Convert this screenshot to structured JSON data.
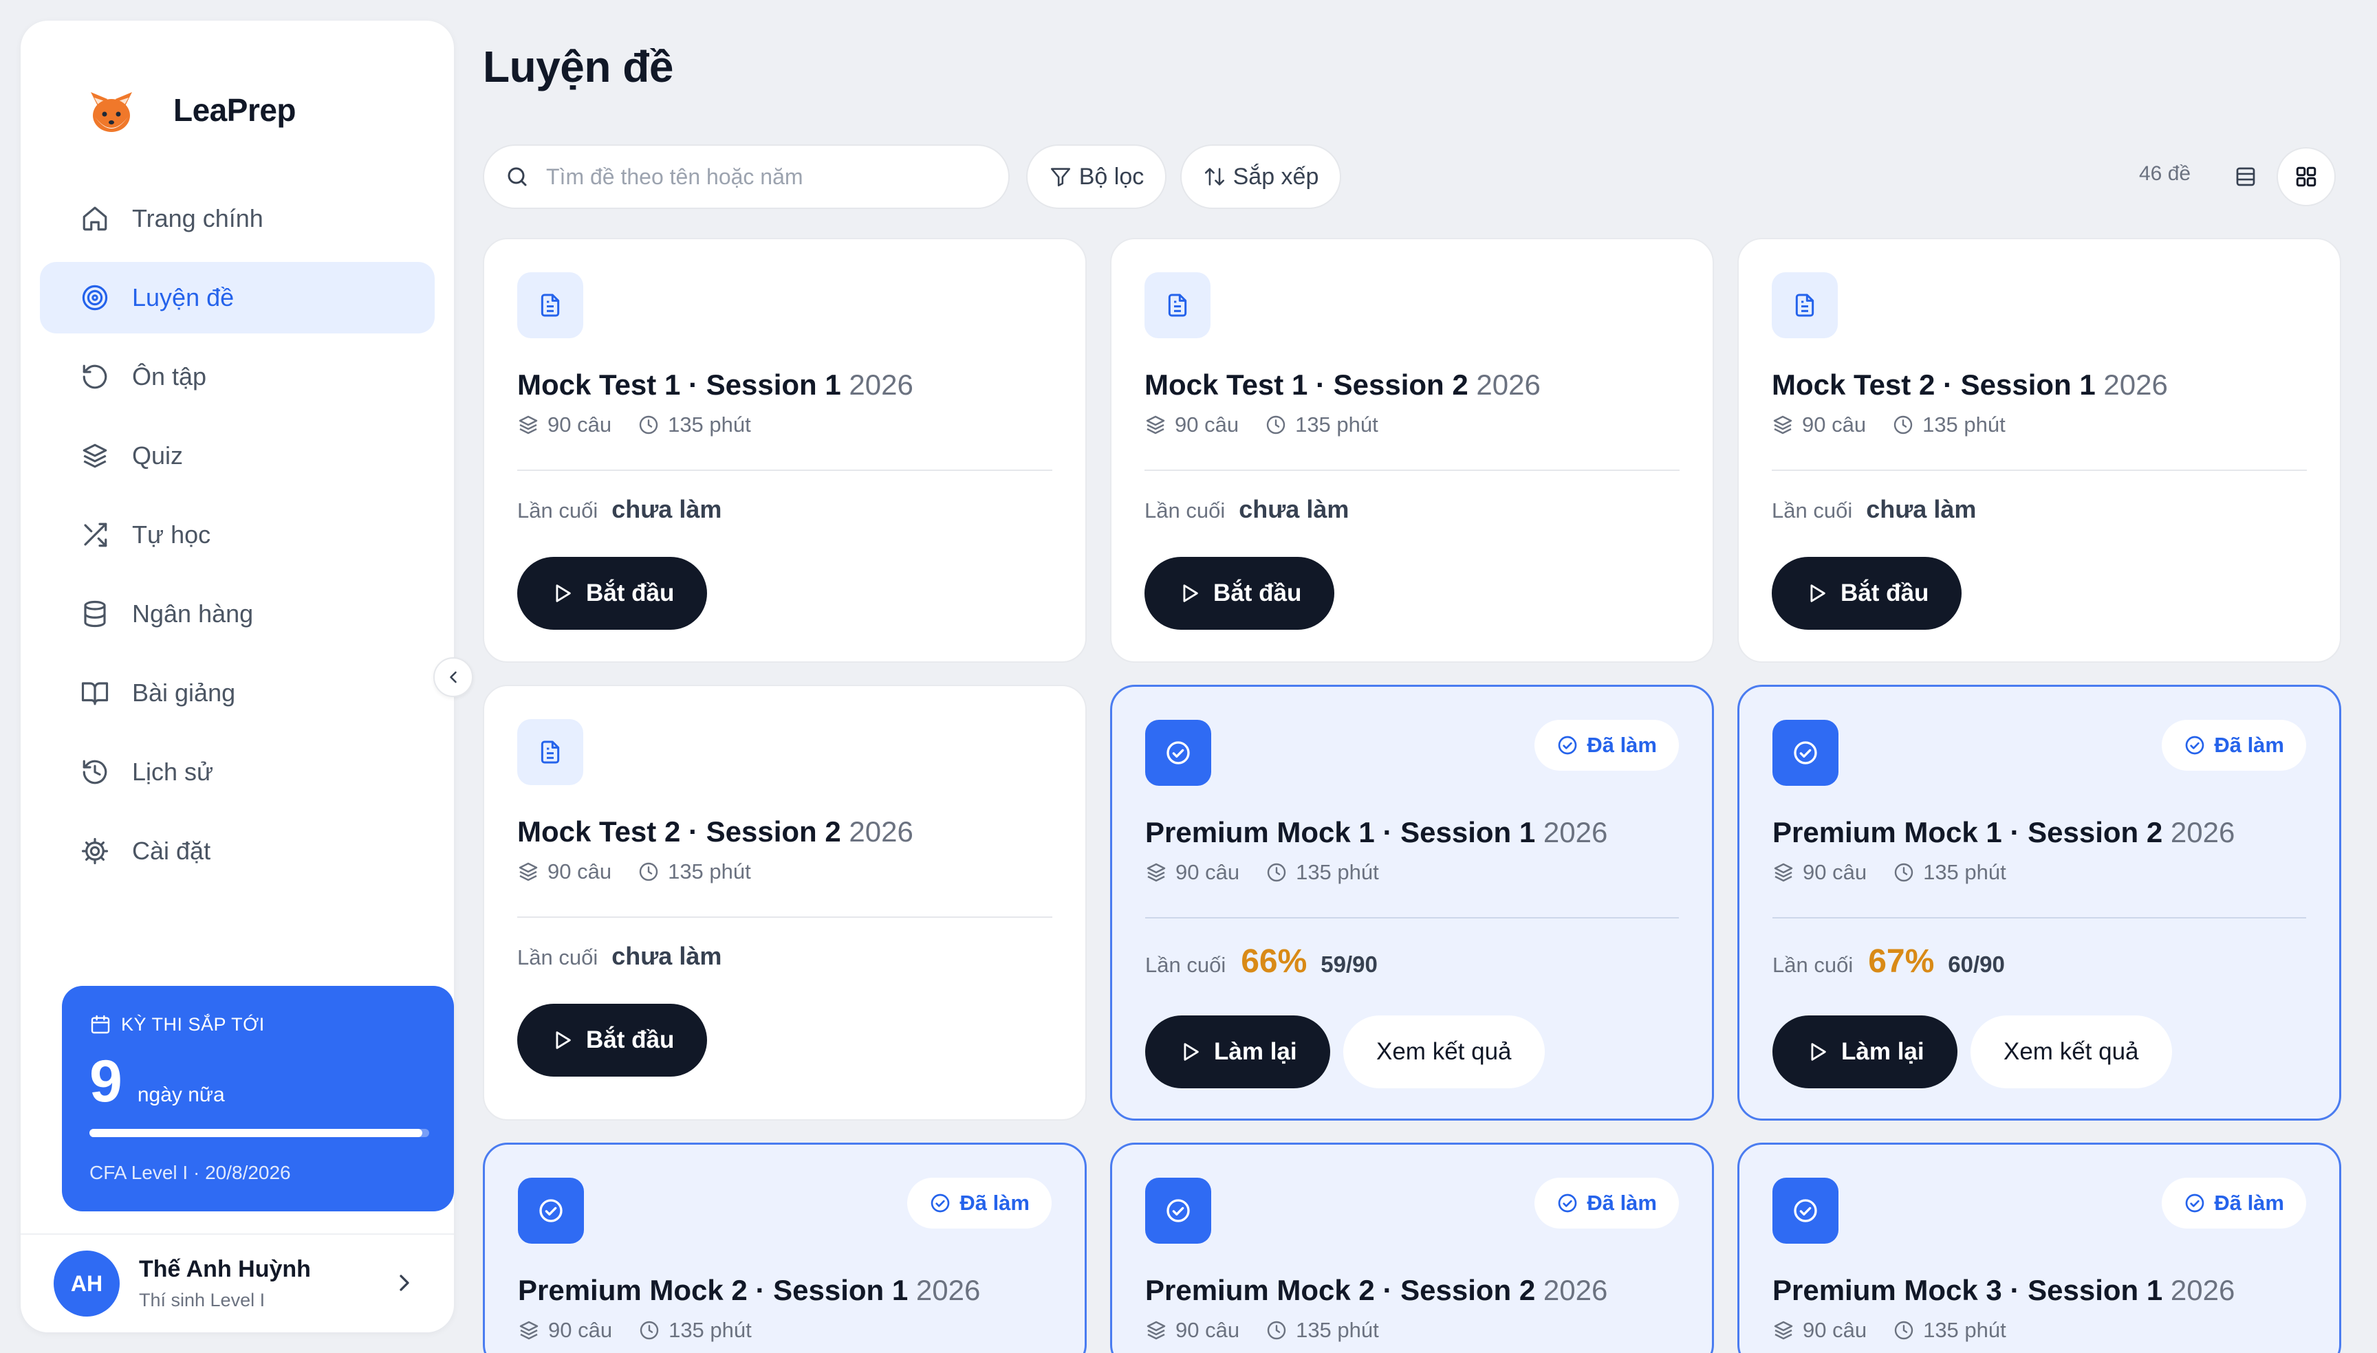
{
  "app": {
    "name": "LeaPrep"
  },
  "sidebar": {
    "items": [
      {
        "label": "Trang chính",
        "icon": "home-icon",
        "active": false
      },
      {
        "label": "Luyện đề",
        "icon": "target-icon",
        "active": true
      },
      {
        "label": "Ôn tập",
        "icon": "rotate-ccw-icon",
        "active": false
      },
      {
        "label": "Quiz",
        "icon": "layers-icon",
        "active": false
      },
      {
        "label": "Tự học",
        "icon": "shuffle-icon",
        "active": false
      },
      {
        "label": "Ngân hàng",
        "icon": "database-icon",
        "active": false
      },
      {
        "label": "Bài giảng",
        "icon": "book-open-icon",
        "active": false
      },
      {
        "label": "Lịch sử",
        "icon": "history-icon",
        "active": false
      },
      {
        "label": "Cài đặt",
        "icon": "gear-icon",
        "active": false
      }
    ],
    "exam": {
      "heading": "KỲ THI SẮP TỚI",
      "days": "9",
      "days_label": "ngày nữa",
      "progress": 0.98,
      "subtitle": "CFA Level I · 20/8/2026"
    },
    "user": {
      "initials": "AH",
      "name": "Thế Anh Huỳnh",
      "role": "Thí sinh Level I"
    }
  },
  "header": {
    "title": "Luyện đề",
    "search_placeholder": "Tìm đề theo tên hoặc năm",
    "filter_label": "Bộ lọc",
    "sort_label": "Sắp xếp",
    "count_label": "46 đề"
  },
  "labels": {
    "last": "Lần cuối",
    "not_done": "chưa làm",
    "start": "Bắt đầu",
    "redo": "Làm lại",
    "view_result": "Xem kết quả",
    "done": "Đã làm"
  },
  "cards": [
    {
      "title": "Mock Test 1 · Session 1",
      "year": "2026",
      "questions": "90 câu",
      "duration": "135 phút",
      "done": false
    },
    {
      "title": "Mock Test 1 · Session 2",
      "year": "2026",
      "questions": "90 câu",
      "duration": "135 phút",
      "done": false
    },
    {
      "title": "Mock Test 2 · Session 1",
      "year": "2026",
      "questions": "90 câu",
      "duration": "135 phút",
      "done": false
    },
    {
      "title": "Mock Test 2 · Session 2",
      "year": "2026",
      "questions": "90 câu",
      "duration": "135 phút",
      "done": false
    },
    {
      "title": "Premium Mock 1 · Session 1",
      "year": "2026",
      "questions": "90 câu",
      "duration": "135 phút",
      "done": true,
      "percent": "66%",
      "score": "59/90"
    },
    {
      "title": "Premium Mock 1 · Session 2",
      "year": "2026",
      "questions": "90 câu",
      "duration": "135 phút",
      "done": true,
      "percent": "67%",
      "score": "60/90"
    },
    {
      "title": "Premium Mock 2 · Session 1",
      "year": "2026",
      "questions": "90 câu",
      "duration": "135 phút",
      "done": true
    },
    {
      "title": "Premium Mock 2 · Session 2",
      "year": "2026",
      "questions": "90 câu",
      "duration": "135 phút",
      "done": true
    },
    {
      "title": "Premium Mock 3 · Session 1",
      "year": "2026",
      "questions": "90 câu",
      "duration": "135 phút",
      "done": true
    }
  ],
  "colors": {
    "accent": "#2f6bf3",
    "active_nav_bg": "#e7efff",
    "done_card_bg": "#edf2fe",
    "score_orange": "#d98a16",
    "dark_button": "#111827"
  }
}
